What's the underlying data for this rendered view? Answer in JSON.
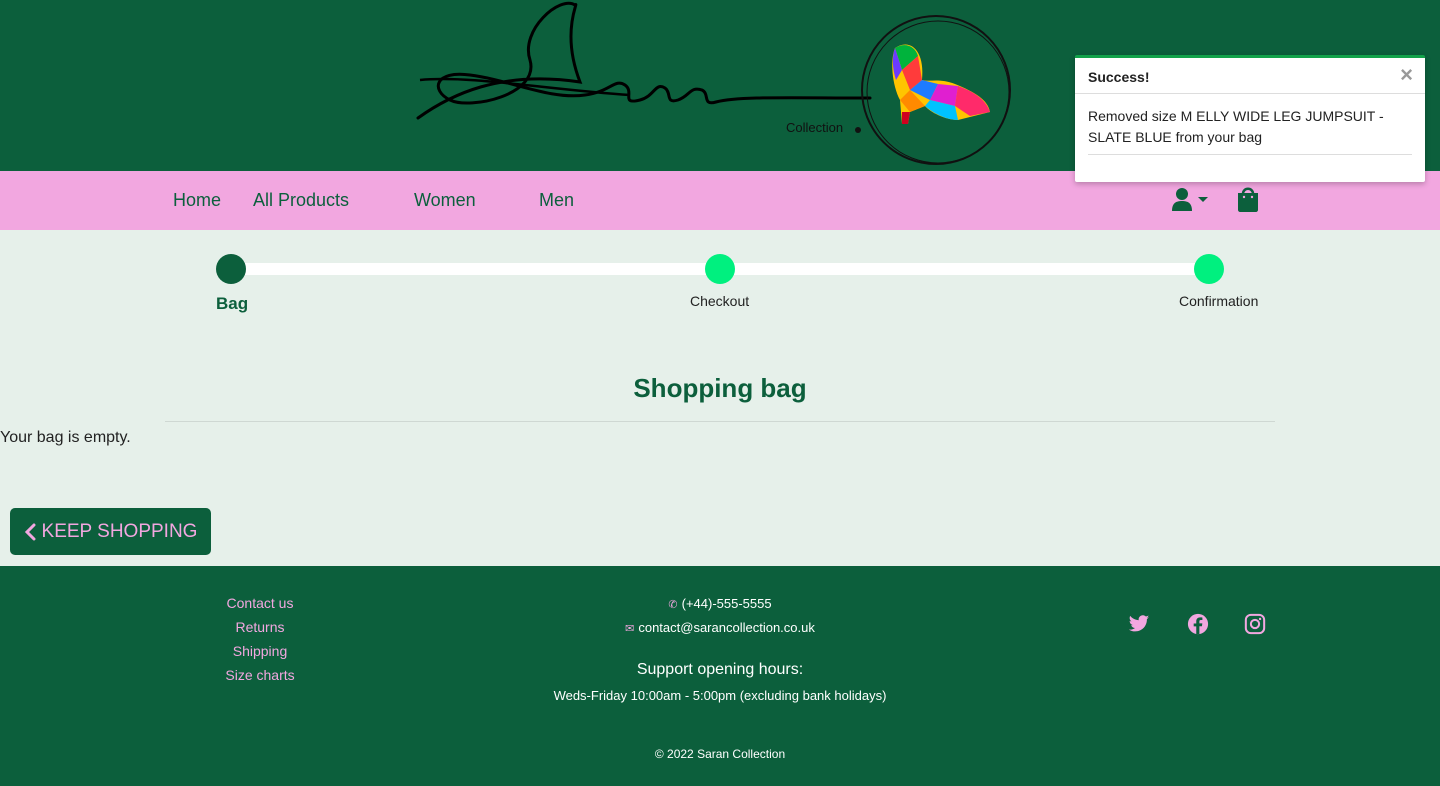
{
  "brand": {
    "logo_text": "Saran",
    "logo_sub": "Collection",
    "header_bg": "#0c5f3c",
    "accent_pink": "#f2a7e0"
  },
  "nav": {
    "items": [
      {
        "label": "Home"
      },
      {
        "label": "All Products"
      },
      {
        "label": "Women"
      },
      {
        "label": "Men"
      }
    ],
    "account_icon": "user-icon",
    "bag_icon": "shopping-bag-icon"
  },
  "toast": {
    "title": "Success!",
    "close": "×",
    "message": "Removed size M ELLY WIDE LEG JUMPSUIT - SLATE BLUE from your bag"
  },
  "progress": {
    "steps": [
      {
        "label": "Bag",
        "state": "active"
      },
      {
        "label": "Checkout",
        "state": "pending"
      },
      {
        "label": "Confirmation",
        "state": "pending"
      }
    ]
  },
  "main": {
    "title": "Shopping bag",
    "empty_message": "Your bag is empty.",
    "keep_shopping": "KEEP SHOPPING"
  },
  "footer": {
    "links": [
      "Contact us",
      "Returns",
      "Shipping",
      "Size charts"
    ],
    "phone": "(+44)-555-5555",
    "email": "contact@sarancollection.co.uk",
    "hours_title": "Support opening hours:",
    "hours": "Weds-Friday 10:00am - 5:00pm (excluding bank holidays)",
    "copyright": "© 2022 Saran Collection",
    "social": [
      "twitter-icon",
      "facebook-icon",
      "instagram-icon"
    ]
  }
}
